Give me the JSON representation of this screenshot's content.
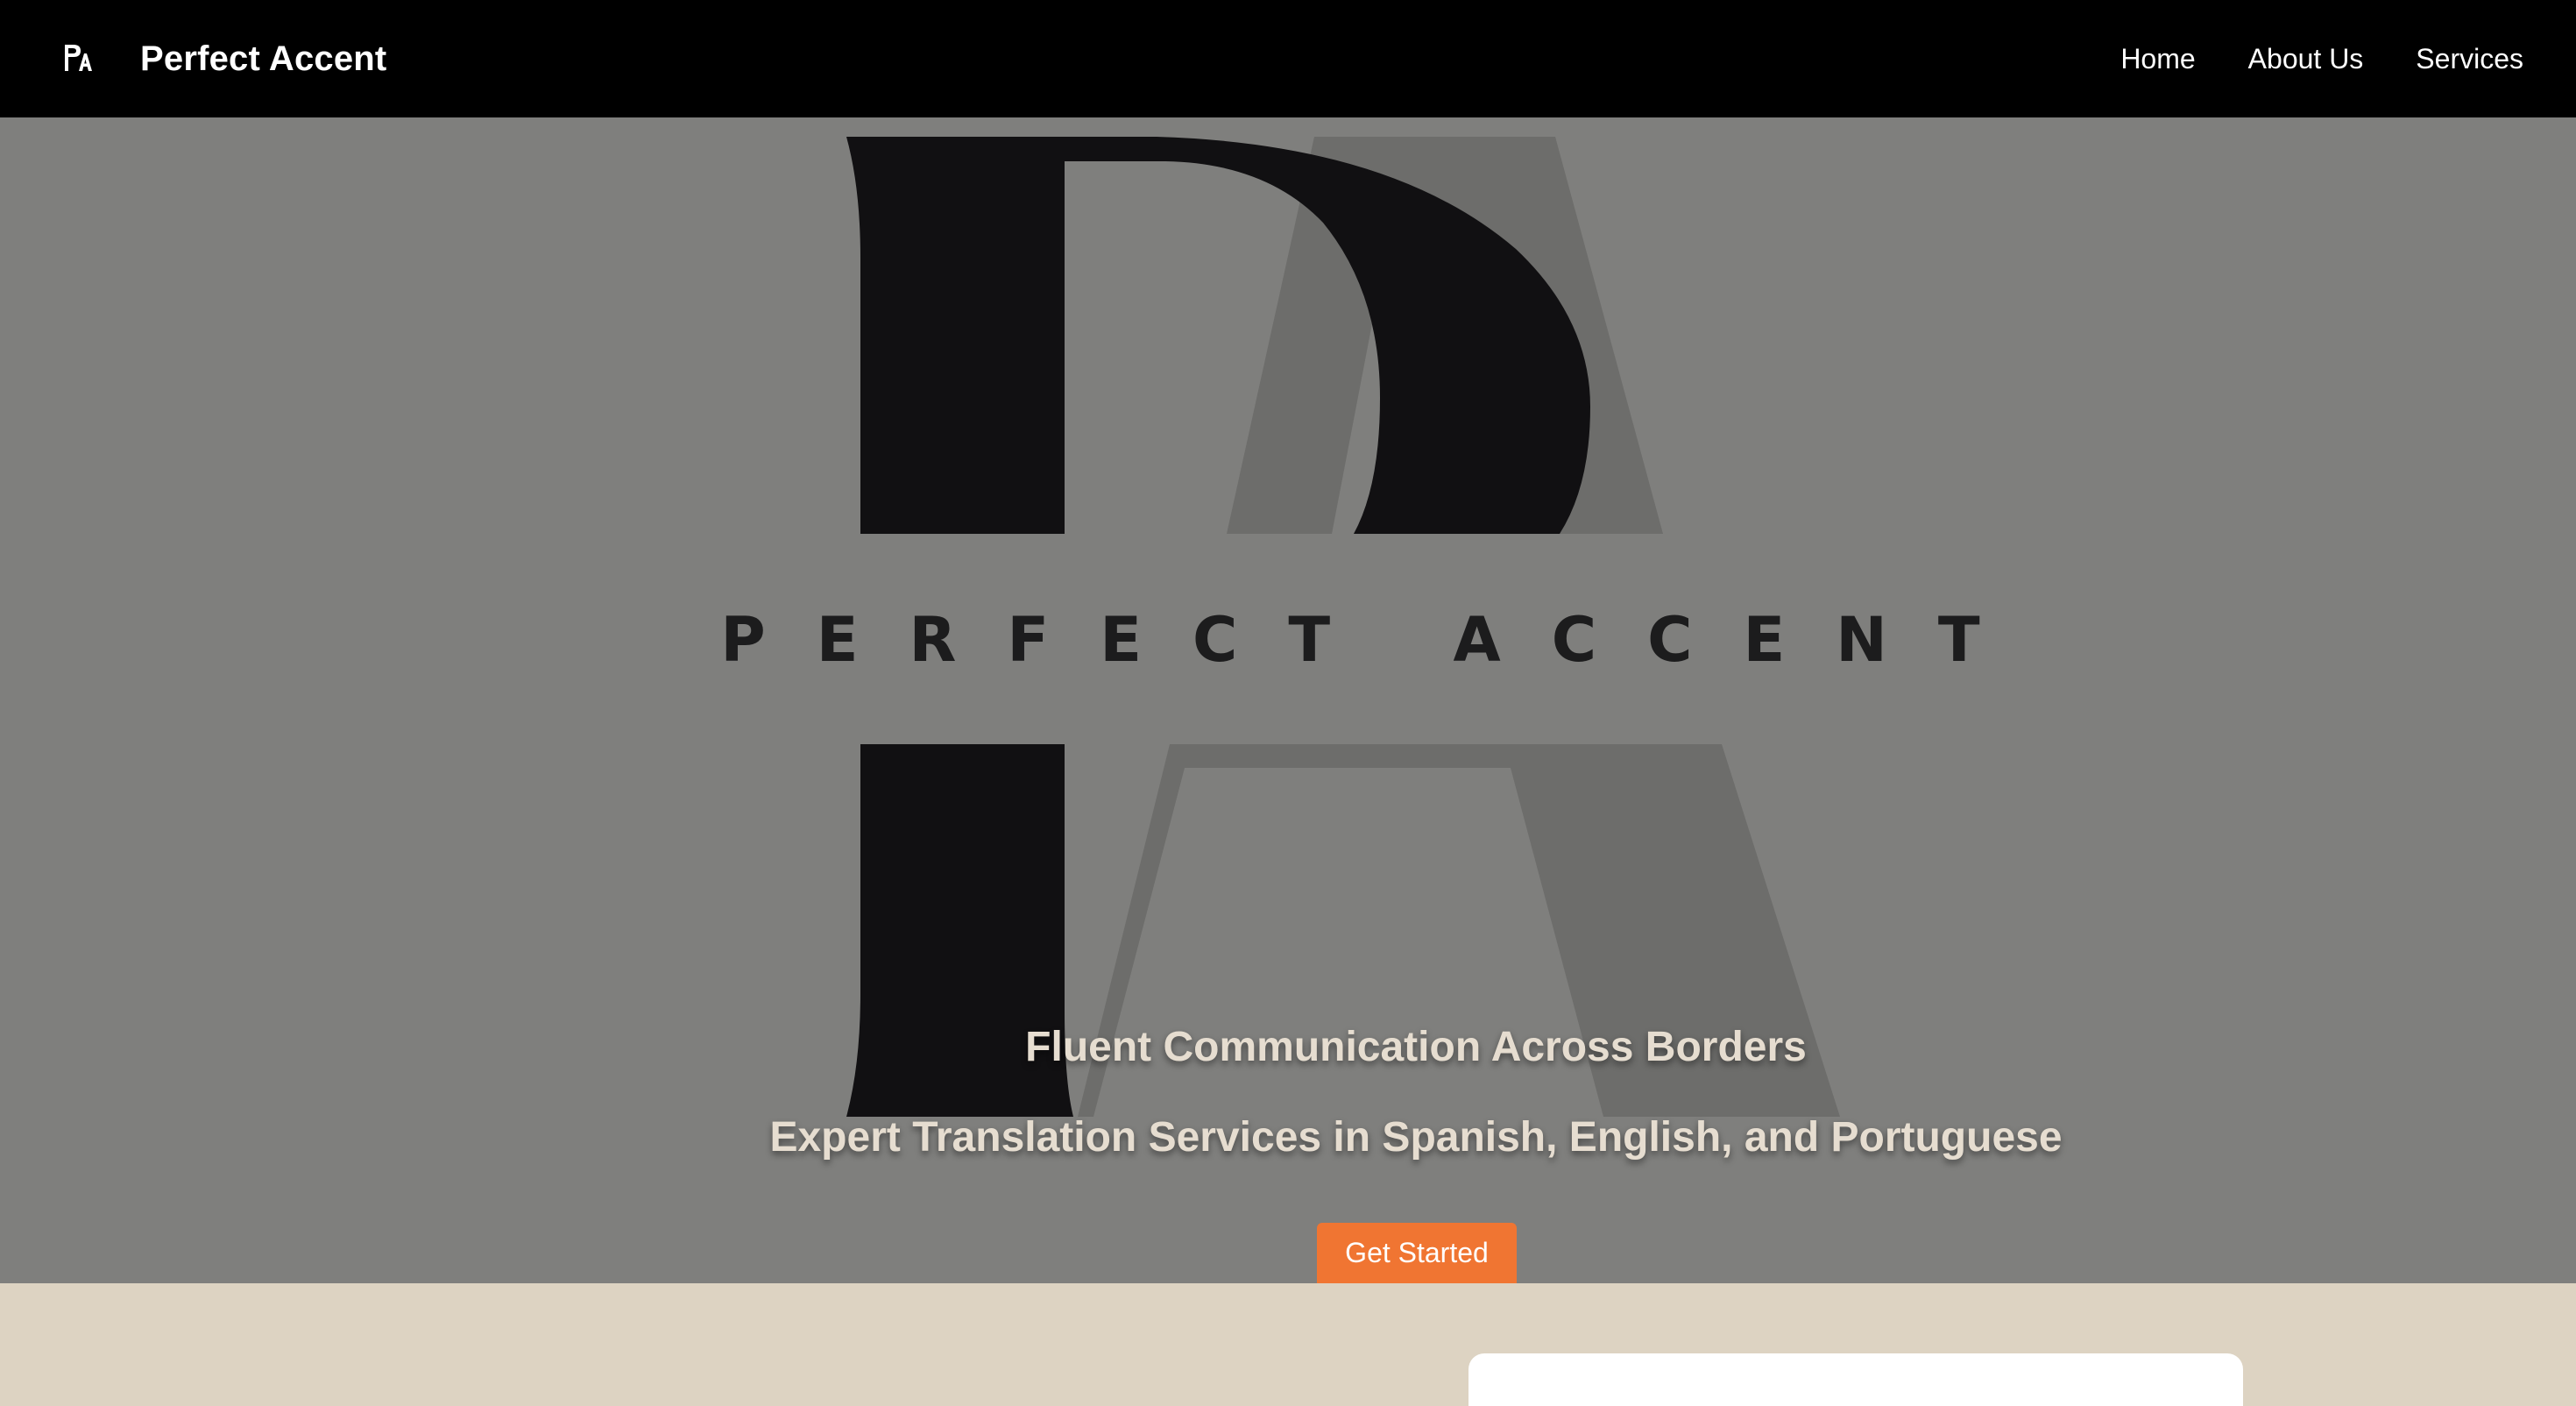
{
  "navbar": {
    "brand_title": "Perfect Accent",
    "logo_icon": "pa-monogram-icon",
    "links": [
      {
        "label": "Home"
      },
      {
        "label": "About Us"
      },
      {
        "label": "Services"
      }
    ]
  },
  "hero": {
    "wordmark": "PERFECT ACCENT",
    "headline": "Fluent Communication Across Borders",
    "subheadline": "Expert Translation Services in Spanish, English, and Portuguese",
    "cta_label": "Get Started"
  },
  "colors": {
    "navbar_bg": "#000000",
    "hero_bg": "#7f7f7d",
    "accent": "#f07532",
    "section_bg": "#ddd3c2",
    "hero_text": "#e6ddd0"
  }
}
